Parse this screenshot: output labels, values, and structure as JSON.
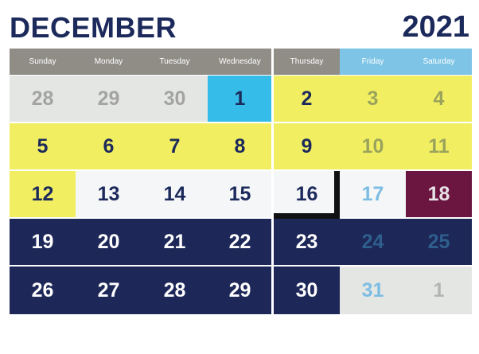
{
  "header": {
    "month": "DECEMBER",
    "year": "2021"
  },
  "weekdays": [
    "Sunday",
    "Monday",
    "Tuesday",
    "Wednesday",
    "Thursday",
    "Friday",
    "Saturday"
  ],
  "weekday_colors": [
    "#8f8d86",
    "#8f8d86",
    "#8f8d86",
    "#8f8d86",
    "#8f8d86",
    "#7dc4e6",
    "#7dc4e6"
  ],
  "weeks": [
    [
      {
        "day": "28",
        "bg": "#e4e6e3",
        "fg": "#a3a3a3"
      },
      {
        "day": "29",
        "bg": "#e4e6e3",
        "fg": "#a3a3a3"
      },
      {
        "day": "30",
        "bg": "#e4e6e3",
        "fg": "#a3a3a3"
      },
      {
        "day": "1",
        "bg": "#35bce9",
        "fg": "#1c2a5b"
      },
      {
        "day": "2",
        "bg": "#f2ee62",
        "fg": "#1c2a5b"
      },
      {
        "day": "3",
        "bg": "#f2ee62",
        "fg": "#9aa35c"
      },
      {
        "day": "4",
        "bg": "#f2ee62",
        "fg": "#9aa35c"
      }
    ],
    [
      {
        "day": "5",
        "bg": "#f2ee62",
        "fg": "#1c2a5b"
      },
      {
        "day": "6",
        "bg": "#f2ee62",
        "fg": "#1c2a5b"
      },
      {
        "day": "7",
        "bg": "#f2ee62",
        "fg": "#1c2a5b"
      },
      {
        "day": "8",
        "bg": "#f2ee62",
        "fg": "#1c2a5b"
      },
      {
        "day": "9",
        "bg": "#f2ee62",
        "fg": "#1c2a5b"
      },
      {
        "day": "10",
        "bg": "#f2ee62",
        "fg": "#9aa35c"
      },
      {
        "day": "11",
        "bg": "#f2ee62",
        "fg": "#9aa35c"
      }
    ],
    [
      {
        "day": "12",
        "bg": "#f2ee62",
        "fg": "#1c2a5b"
      },
      {
        "day": "13",
        "bg": "#f5f6f8",
        "fg": "#1c2a5b"
      },
      {
        "day": "14",
        "bg": "#f5f6f8",
        "fg": "#1c2a5b"
      },
      {
        "day": "15",
        "bg": "#f5f6f8",
        "fg": "#1c2a5b"
      },
      {
        "day": "16",
        "bg": "#f5f6f8",
        "fg": "#1c2a5b"
      },
      {
        "day": "17",
        "bg": "#f5f6f8",
        "fg": "#7dbde3"
      },
      {
        "day": "18",
        "bg": "#6b1640",
        "fg": "#e8e1e6"
      }
    ],
    [
      {
        "day": "19",
        "bg": "#1d2758",
        "fg": "#ffffff"
      },
      {
        "day": "20",
        "bg": "#1d2758",
        "fg": "#ffffff"
      },
      {
        "day": "21",
        "bg": "#1d2758",
        "fg": "#ffffff"
      },
      {
        "day": "22",
        "bg": "#1d2758",
        "fg": "#ffffff"
      },
      {
        "day": "23",
        "bg": "#1d2758",
        "fg": "#ffffff"
      },
      {
        "day": "24",
        "bg": "#1d2758",
        "fg": "#2e5f8c"
      },
      {
        "day": "25",
        "bg": "#1d2758",
        "fg": "#2e5f8c"
      }
    ],
    [
      {
        "day": "26",
        "bg": "#1d2758",
        "fg": "#ffffff"
      },
      {
        "day": "27",
        "bg": "#1d2758",
        "fg": "#ffffff"
      },
      {
        "day": "28",
        "bg": "#1d2758",
        "fg": "#ffffff"
      },
      {
        "day": "29",
        "bg": "#1d2758",
        "fg": "#ffffff"
      },
      {
        "day": "30",
        "bg": "#1d2758",
        "fg": "#ffffff"
      },
      {
        "day": "31",
        "bg": "#e4e6e3",
        "fg": "#7dbde3"
      },
      {
        "day": "1",
        "bg": "#e4e6e3",
        "fg": "#b3b3b3"
      }
    ]
  ]
}
